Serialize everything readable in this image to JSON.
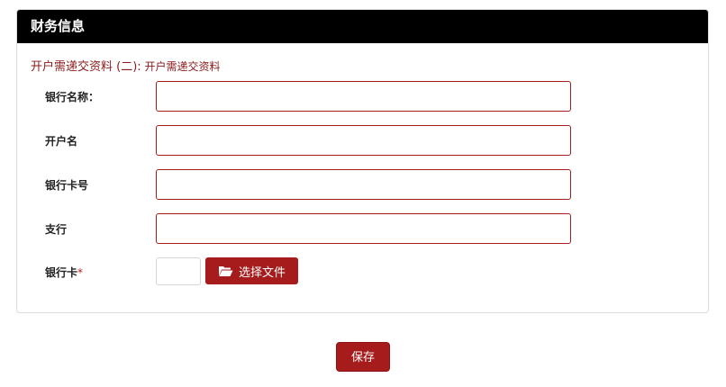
{
  "panel": {
    "title": "财务信息"
  },
  "notice": {
    "main": "开户需递交资料 (二):",
    "sub": "开户需递交资料"
  },
  "fields": {
    "bank_name": {
      "label": "银行名称：",
      "value": ""
    },
    "account_name": {
      "label": "开户名",
      "value": ""
    },
    "card_number": {
      "label": "银行卡号",
      "value": ""
    },
    "branch": {
      "label": "支行",
      "value": ""
    },
    "bank_card": {
      "label": "银行卡",
      "required_mark": "*"
    }
  },
  "file_upload": {
    "button_label": "选择文件",
    "icon": "folder-open-icon"
  },
  "actions": {
    "save_label": "保存"
  },
  "colors": {
    "header_bg": "#000000",
    "accent": "#a61c1c",
    "notice_text": "#8b1a1a"
  }
}
